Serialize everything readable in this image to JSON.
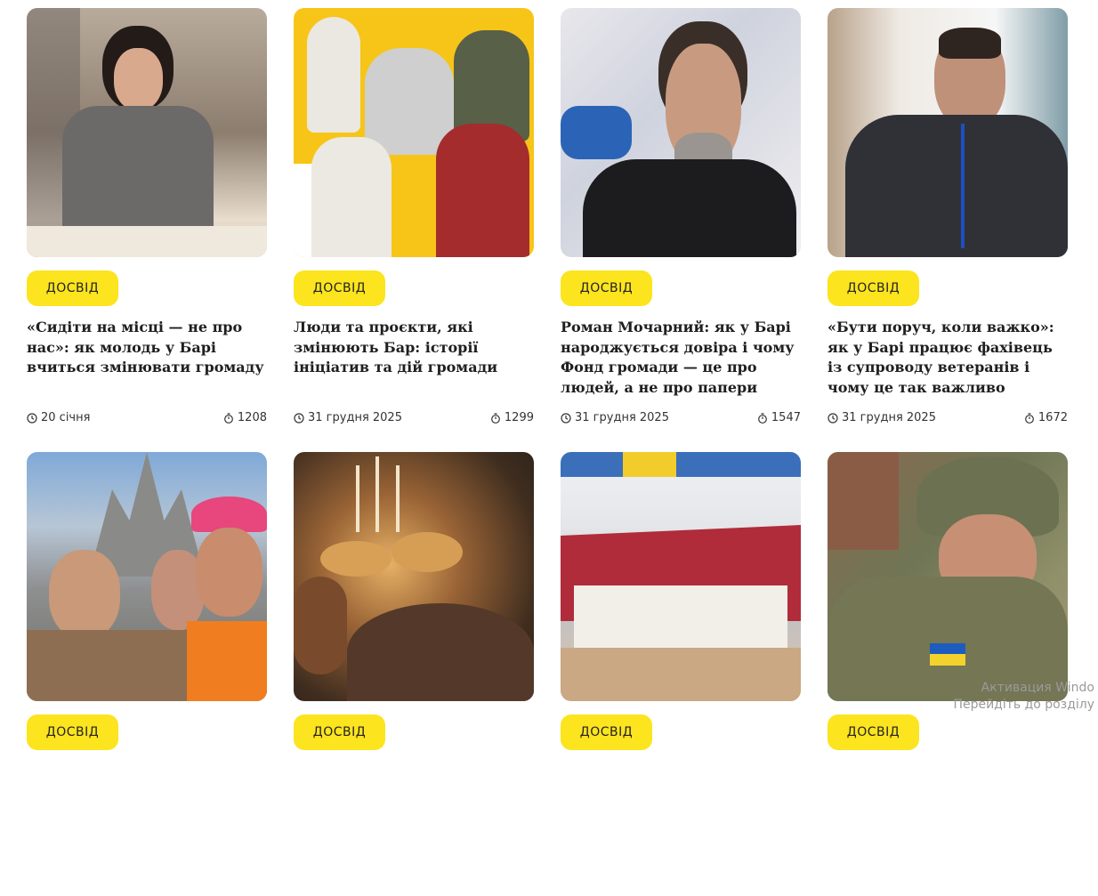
{
  "cards": [
    {
      "badge": "ДОСВІД",
      "title": "«Сидіти на місці — не про нас»: як молодь у Барі вчиться змінювати громаду",
      "date": "20 січня",
      "views": "1208"
    },
    {
      "badge": "ДОСВІД",
      "title": "Люди та проєкти, які змінюють Бар: історії ініціатив та дій громади",
      "date": "31 грудня 2025",
      "views": "1299"
    },
    {
      "badge": "ДОСВІД",
      "title": "Роман Мочарний: як у Барі народжується довіра і чому Фонд громади — це про людей, а не про папери",
      "date": "31 грудня 2025",
      "views": "1547"
    },
    {
      "badge": "ДОСВІД",
      "title": "«Бути поруч, коли важко»: як у Барі працює фахівець із супроводу ветеранів і чому це так важливо",
      "date": "31 грудня 2025",
      "views": "1672"
    },
    {
      "badge": "ДОСВІД"
    },
    {
      "badge": "ДОСВІД"
    },
    {
      "badge": "ДОСВІД"
    },
    {
      "badge": "ДОСВІД"
    }
  ],
  "watermark": {
    "line1": "Активация Windo",
    "line2": "Перейдіть до розділу"
  },
  "icons": {
    "date": "clock-icon",
    "views": "timer-icon"
  },
  "colors": {
    "badge": "#fce41e",
    "title": "#1f1f1f",
    "meta": "#333333"
  }
}
